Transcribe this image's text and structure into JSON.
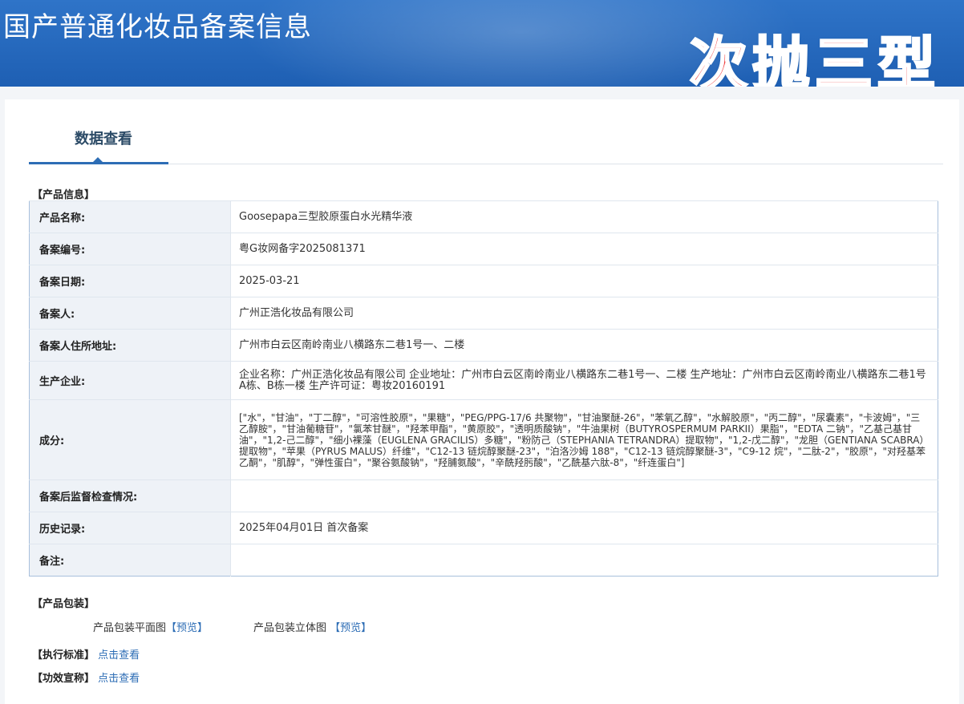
{
  "header": {
    "site_title": "国产普通化妆品备案信息",
    "stamp_text": "次抛三型"
  },
  "tabs": [
    {
      "label": "数据查看"
    }
  ],
  "product_info": {
    "section_title": "【产品信息】",
    "rows": [
      {
        "label": "产品名称:",
        "value": "Goosepapa三型胶原蛋白水光精华液"
      },
      {
        "label": "备案编号:",
        "value": "粤G妆网备字2025081371"
      },
      {
        "label": "备案日期:",
        "value": "2025-03-21"
      },
      {
        "label": "备案人:",
        "value": "广州正浩化妆品有限公司"
      },
      {
        "label": "备案人住所地址:",
        "value": "广州市白云区南岭南业八横路东二巷1号一、二楼"
      },
      {
        "label": "生产企业:",
        "value": "企业名称：广州正浩化妆品有限公司 企业地址：广州市白云区南岭南业八横路东二巷1号一、二楼 生产地址：广州市白云区南岭南业八横路东二巷1号A栋、B栋一楼 生产许可证：粤妆20160191"
      },
      {
        "label": "成分:",
        "value": "[\"水\"，\"甘油\"，\"丁二醇\"，\"可溶性胶原\"，\"果糖\"，\"PEG/PPG-17/6 共聚物\"，\"甘油聚醚-26\"，\"苯氧乙醇\"，\"水解胶原\"，\"丙二醇\"，\"尿囊素\"，\"卡波姆\"，\"三乙醇胺\"，\"甘油葡糖苷\"，\"氯苯甘醚\"，\"羟苯甲酯\"，\"黄原胶\"，\"透明质酸钠\"，\"牛油果树（BUTYROSPERMUM PARKII）果脂\"，\"EDTA 二钠\"，\"乙基己基甘油\"，\"1,2-己二醇\"，\"细小裸藻（EUGLENA GRACILIS）多糖\"，\"粉防己（STEPHANIA TETRANDRA）提取物\"，\"1,2-戊二醇\"，\"龙胆（GENTIANA SCABRA）提取物\"，\"苹果（PYRUS MALUS）纤维\"，\"C12-13 链烷醇聚醚-23\"，\"泊洛沙姆 188\"，\"C12-13 链烷醇聚醚-3\"，\"C9-12 烷\"，\"二肽-2\"，\"胶原\"，\"对羟基苯乙酮\"，\"肌醇\"，\"弹性蛋白\"，\"聚谷氨酸钠\"，\"羟脯氨酸\"，\"辛酰羟肟酸\"，\"乙酰基六肽-8\"，\"纤连蛋白\"]"
      },
      {
        "label": "备案后监督检查情况:",
        "value": ""
      },
      {
        "label": "历史记录:",
        "value": "2025年04月01日 首次备案"
      },
      {
        "label": "备注:",
        "value": ""
      }
    ]
  },
  "packaging": {
    "section_title": "【产品包装】",
    "plan_label": "产品包装平面图",
    "plan_link": "【预览】",
    "solid_label": "产品包装立体图",
    "solid_link": "【预览】"
  },
  "standard": {
    "section_title": "【执行标准】",
    "link": "点击查看"
  },
  "efficacy": {
    "section_title": "【功效宣称】",
    "link": "点击查看"
  },
  "colors": {
    "header_blue": "#1e5fb3",
    "link_blue": "#2d6db5",
    "stamp_red": "#ef3b3b"
  }
}
